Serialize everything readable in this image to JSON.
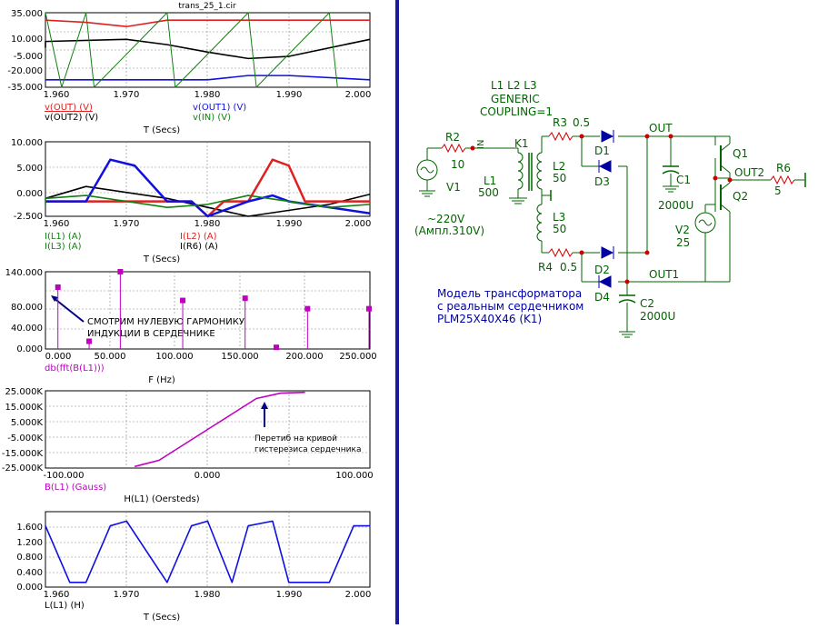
{
  "window": {
    "title": "trans_25_1.cir"
  },
  "colors": {
    "red": "#e02020",
    "black": "#000000",
    "blue": "#1010e0",
    "green": "#108010",
    "magenta": "#c000c0",
    "navy": "#0000a0",
    "schem_green": "#006400",
    "schem_red": "#cc0000",
    "divider": "#1a1aa0"
  },
  "plot1": {
    "y_ticks": [
      "35.000",
      "10.000",
      "-5.000",
      "-20.000",
      "-35.000"
    ],
    "x_ticks": [
      "1.960",
      "1.970",
      "1.980",
      "1.990",
      "2.000"
    ],
    "legend": [
      "v(OUT) (V)",
      "v(OUT1) (V)",
      "v(OUT2) (V)",
      "v(IN) (V)"
    ],
    "x_title": "T (Secs)"
  },
  "plot2": {
    "y_ticks": [
      "10.000",
      "5.000",
      "0.000",
      "-2.500"
    ],
    "x_ticks": [
      "1.960",
      "1.970",
      "1.980",
      "1.990",
      "2.000"
    ],
    "legend": [
      "I(L1) (A)",
      "I(L2) (A)",
      "I(L3) (A)",
      "I(R6) (A)"
    ],
    "x_title": "T (Secs)"
  },
  "plot3": {
    "y_ticks": [
      "140.000",
      "80.000",
      "40.000",
      "0.000"
    ],
    "x_ticks": [
      "0.000",
      "50.000",
      "100.000",
      "150.000",
      "200.000",
      "250.000"
    ],
    "legend": [
      "db(fft(B(L1)))"
    ],
    "x_title": "F (Hz)",
    "annotation": [
      "СМОТРИМ НУЛЕВУЮ ГАРМОНИКУ",
      "ИНДУКЦИИ В СЕРДЕЧНИКЕ"
    ]
  },
  "plot4": {
    "y_ticks": [
      "25.000K",
      "15.000K",
      "5.000K",
      "-5.000K",
      "-15.000K",
      "-25.000K"
    ],
    "x_ticks": [
      "-100.000",
      "0.000",
      "100.000"
    ],
    "legend": [
      "B(L1) (Gauss)"
    ],
    "x_title": "H(L1) (Oersteds)",
    "annotation": [
      "Перетиб на кривой",
      "гистерезиса сердечника"
    ]
  },
  "plot5": {
    "y_ticks": [
      "1.600",
      "1.200",
      "0.800",
      "0.400",
      "0.000"
    ],
    "x_ticks": [
      "1.960",
      "1.970",
      "1.980",
      "1.990",
      "2.000"
    ],
    "legend": [
      "L(L1) (H)"
    ],
    "x_title": "T (Secs)"
  },
  "chart_data": [
    {
      "type": "line",
      "x_range": [
        1.96,
        2.0
      ],
      "ylim": [
        -35,
        35
      ],
      "series": [
        {
          "name": "v(OUT) (V)",
          "color": "#e02020",
          "x": [
            1.955,
            1.965,
            1.97,
            1.975,
            1.98,
            1.99,
            2.0
          ],
          "y": [
            28,
            26,
            22,
            28,
            28,
            28,
            28
          ]
        },
        {
          "name": "v(OUT1) (V)",
          "color": "#1010e0",
          "x": [
            1.955,
            1.97,
            1.98,
            1.985,
            1.99,
            2.0
          ],
          "y": [
            -28,
            -28,
            -28,
            -24,
            -24,
            -28
          ]
        },
        {
          "name": "v(OUT2) (V)",
          "color": "#000000",
          "x": [
            1.955,
            1.96,
            1.97,
            1.975,
            1.98,
            1.985,
            1.99,
            2.0
          ],
          "y": [
            2,
            8,
            10,
            5,
            -2,
            -8,
            -6,
            10
          ]
        },
        {
          "name": "v(IN) (V)",
          "color": "#108010",
          "x": [
            1.955,
            1.962,
            1.965,
            1.966,
            1.975,
            1.976,
            1.985,
            1.986,
            1.995,
            1.996
          ],
          "y": [
            310,
            -310,
            310,
            -310,
            310,
            -310,
            310,
            -310,
            310,
            -310
          ]
        }
      ]
    },
    {
      "type": "line",
      "x_range": [
        1.96,
        2.0
      ],
      "ylim": [
        -2.5,
        10
      ],
      "series": [
        {
          "name": "I(L1) (A)",
          "color": "#000000",
          "x": [
            1.955,
            1.965,
            1.975,
            1.985,
            1.995,
            2.0
          ],
          "y": [
            0.5,
            2.5,
            0.5,
            -2.5,
            -0.5,
            1.2
          ]
        },
        {
          "name": "I(L2) (A)",
          "color": "#e02020",
          "x": [
            1.955,
            1.97,
            1.972,
            1.978,
            1.98,
            1.982,
            1.985,
            1.988,
            1.99,
            1.992,
            2.0
          ],
          "y": [
            0,
            0,
            0,
            0,
            -2.5,
            0,
            0,
            7,
            6,
            0,
            0
          ]
        },
        {
          "name": "I(L3) (A)",
          "color": "#1010e0",
          "x": [
            1.955,
            1.965,
            1.968,
            1.971,
            1.975,
            1.978,
            1.98,
            1.985,
            1.988,
            1.99,
            2.0
          ],
          "y": [
            0,
            0,
            7,
            6,
            0,
            0,
            -2.5,
            0,
            1,
            0,
            -2
          ]
        },
        {
          "name": "I(R6) (A)",
          "color": "#108010",
          "x": [
            1.955,
            1.96,
            1.965,
            1.97,
            1.975,
            1.98,
            1.985,
            1.99,
            1.995,
            2.0
          ],
          "y": [
            -0.5,
            0.5,
            1,
            0,
            -1,
            -0.5,
            1,
            0,
            -1,
            -0.5
          ]
        }
      ]
    },
    {
      "type": "bar",
      "x_range": [
        -10,
        250
      ],
      "ylim": [
        0,
        140
      ],
      "series": [
        {
          "name": "db(fft(B(L1)))",
          "color": "#c000c0",
          "x": [
            0,
            25,
            50,
            100,
            150,
            175,
            200,
            250
          ],
          "y": [
            112,
            14,
            140,
            88,
            92,
            3,
            73,
            73
          ]
        }
      ]
    },
    {
      "type": "line",
      "x_range": [
        -100,
        100
      ],
      "ylim": [
        -25000,
        25000
      ],
      "series": [
        {
          "name": "B(L1) (Gauss)",
          "color": "#c000c0",
          "x": [
            -45,
            -30,
            -15,
            0,
            15,
            30,
            45,
            60
          ],
          "y": [
            -24000,
            -20000,
            -10000,
            0,
            10000,
            20000,
            23500,
            24000
          ]
        }
      ]
    },
    {
      "type": "line",
      "x_range": [
        1.96,
        2.0
      ],
      "ylim": [
        0,
        1.6
      ],
      "series": [
        {
          "name": "L(L1) (H)",
          "color": "#1010e0",
          "x": [
            1.955,
            1.96,
            1.963,
            1.965,
            1.968,
            1.97,
            1.975,
            1.978,
            1.98,
            1.983,
            1.985,
            1.988,
            1.99,
            1.995,
            1.998,
            2.0
          ],
          "y": [
            1.3,
            1.3,
            0.1,
            0.1,
            1.3,
            1.4,
            0.1,
            1.3,
            1.4,
            0.1,
            1.3,
            1.4,
            0.1,
            0.1,
            1.3,
            1.3
          ]
        }
      ]
    }
  ],
  "schematic": {
    "net_in": "IN",
    "net_out": "OUT",
    "net_out1": "OUT1",
    "net_out2": "OUT2",
    "r2": {
      "name": "R2",
      "value": "10"
    },
    "v1": {
      "name": "V1",
      "value": "~220V",
      "value2": "(Ампл.310V)"
    },
    "l1": {
      "name": "L1",
      "value": "500"
    },
    "l2": {
      "name": "L2",
      "value": "50"
    },
    "l3": {
      "name": "L3",
      "value": "50"
    },
    "k1": "K1",
    "coupling": [
      "L1 L2 L3",
      "GENERIC",
      "COUPLING=1"
    ],
    "r3": {
      "name": "R3",
      "value": "0.5"
    },
    "r4": {
      "name": "R4",
      "value": "0.5"
    },
    "diodes": [
      "D1",
      "D2",
      "D3",
      "D4"
    ],
    "c1": {
      "name": "C1",
      "value": "2000U"
    },
    "c2": {
      "name": "C2",
      "value": "2000U"
    },
    "q1": "Q1",
    "q2": "Q2",
    "v2": {
      "name": "V2",
      "value": "25"
    },
    "r6": {
      "name": "R6",
      "value": "5"
    },
    "note": [
      "Модель трансформатора",
      "с реальным сердечником",
      "PLM25X40X46 (K1)"
    ]
  }
}
